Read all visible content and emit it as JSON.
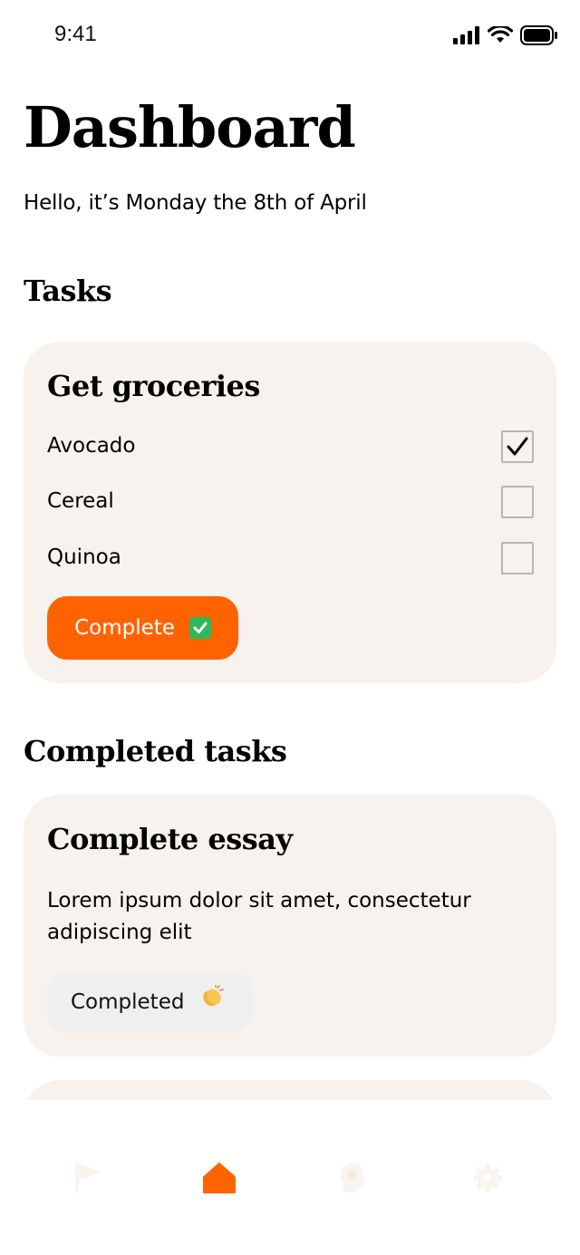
{
  "status_bar": {
    "time": "9:41"
  },
  "header": {
    "title": "Dashboard",
    "greeting": "Hello, it’s Monday the 8th of April"
  },
  "tasks_section": {
    "heading": "Tasks",
    "card": {
      "title": "Get groceries",
      "items": [
        {
          "label": "Avocado",
          "checked": true
        },
        {
          "label": "Cereal",
          "checked": false
        },
        {
          "label": "Quinoa",
          "checked": false
        }
      ],
      "button_label": "Complete",
      "button_emoji_icon": "check-mark-button-emoji-icon"
    }
  },
  "completed_section": {
    "heading": "Completed tasks",
    "card": {
      "title": "Complete essay",
      "description": "Lorem ipsum dolor sit amet, consectetur adipiscing elit",
      "badge_label": "Completed",
      "badge_emoji_icon": "clapping-hands-emoji-icon"
    }
  },
  "bottom_nav": {
    "items": [
      {
        "icon": "flag-icon",
        "active": false
      },
      {
        "icon": "home-icon",
        "active": true
      },
      {
        "icon": "brain-head-icon",
        "active": false
      },
      {
        "icon": "gear-icon",
        "active": false
      }
    ]
  },
  "colors": {
    "accent": "#ff6300",
    "card_background": "#f7f2ed",
    "nav_inactive": "#faf4ee",
    "completed_badge": "#efefef"
  }
}
